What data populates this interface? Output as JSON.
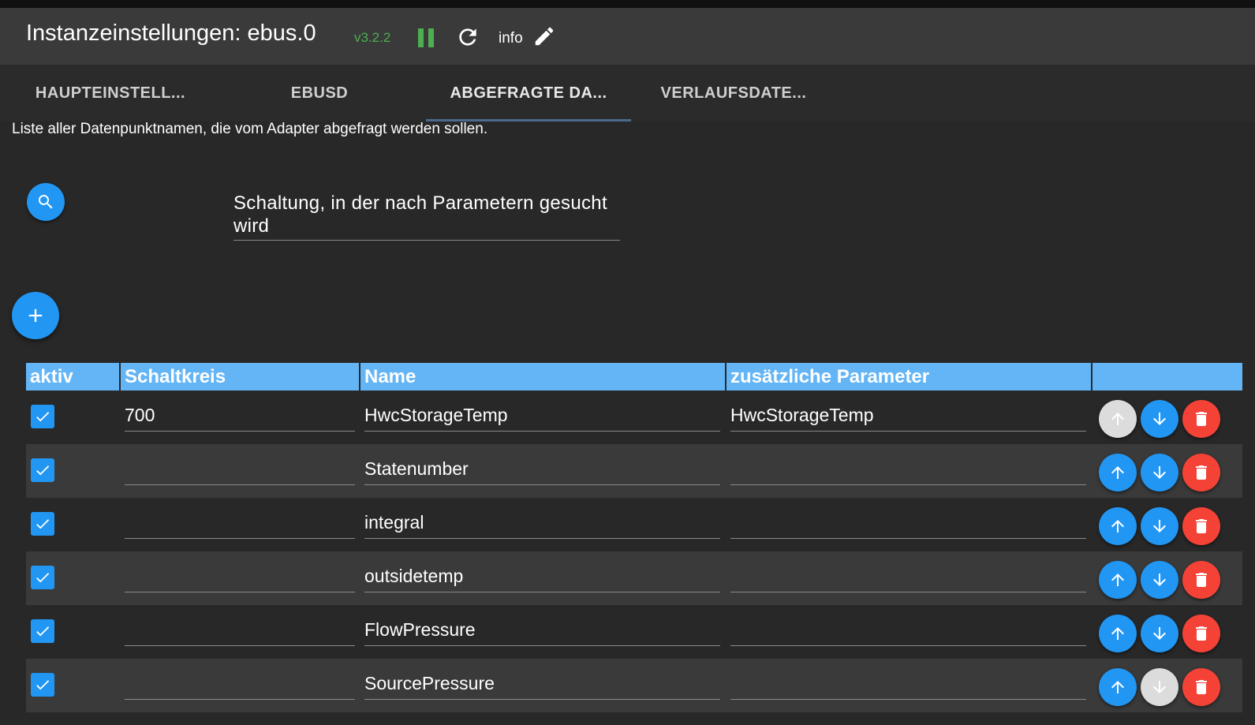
{
  "header": {
    "title": "Instanzeinstellungen: ebus.0",
    "version": "v3.2.2",
    "info_label": "info",
    "status_color": "#4caf50"
  },
  "tabs": [
    {
      "label": "HAUPTEINSTELL...",
      "active": false
    },
    {
      "label": "EBUSD",
      "active": false
    },
    {
      "label": "ABGEFRAGTE DA...",
      "active": true
    },
    {
      "label": "VERLAUFSDATE...",
      "active": false
    }
  ],
  "description": "Liste aller Datenpunktnamen, die vom Adapter abgefragt werden sollen.",
  "search": {
    "label_line1": "Schaltung, in der nach Parametern gesucht",
    "label_line2": "wird"
  },
  "table": {
    "headers": [
      "aktiv",
      "Schaltkreis",
      "Name",
      "zusätzliche Parameter"
    ],
    "rows": [
      {
        "aktiv": true,
        "schaltkreis": "700",
        "name": "HwcStorageTemp",
        "parameter": "HwcStorageTemp",
        "up_enabled": false,
        "down_enabled": true
      },
      {
        "aktiv": true,
        "schaltkreis": "",
        "name": "Statenumber",
        "parameter": "",
        "up_enabled": true,
        "down_enabled": true
      },
      {
        "aktiv": true,
        "schaltkreis": "",
        "name": "integral",
        "parameter": "",
        "up_enabled": true,
        "down_enabled": true
      },
      {
        "aktiv": true,
        "schaltkreis": "",
        "name": "outsidetemp",
        "parameter": "",
        "up_enabled": true,
        "down_enabled": true
      },
      {
        "aktiv": true,
        "schaltkreis": "",
        "name": "FlowPressure",
        "parameter": "",
        "up_enabled": true,
        "down_enabled": true
      },
      {
        "aktiv": true,
        "schaltkreis": "",
        "name": "SourcePressure",
        "parameter": "",
        "up_enabled": true,
        "down_enabled": false
      }
    ]
  },
  "colors": {
    "accent": "#2196f3",
    "header_row": "#64b5f6",
    "delete": "#f44336",
    "disabled": "#dcdcdc"
  },
  "icons": [
    "pause-icon",
    "reload-icon",
    "edit-icon",
    "search-icon",
    "add-icon",
    "check-icon",
    "arrow-up-icon",
    "arrow-down-icon",
    "delete-icon"
  ]
}
